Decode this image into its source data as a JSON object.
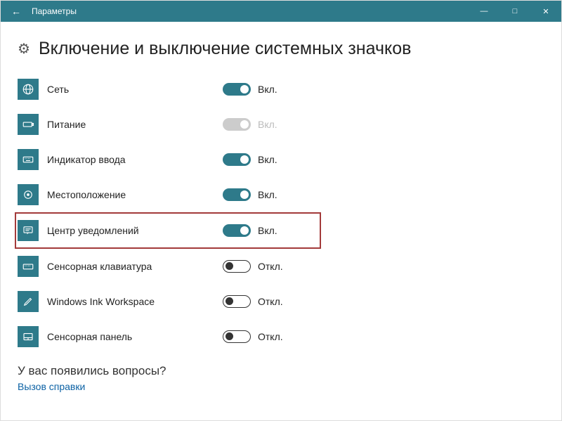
{
  "titlebar": {
    "title": "Параметры"
  },
  "heading": "Включение и выключение системных значков",
  "on_label": "Вкл.",
  "off_label": "Откл.",
  "items": {
    "network": {
      "label": "Сеть",
      "state": "on",
      "icon": "globe"
    },
    "power": {
      "label": "Питание",
      "state": "disabled",
      "icon": "battery"
    },
    "input": {
      "label": "Индикатор ввода",
      "state": "on",
      "icon": "keyboard"
    },
    "location": {
      "label": "Местоположение",
      "state": "on",
      "icon": "location"
    },
    "action": {
      "label": "Центр уведомлений",
      "state": "on",
      "icon": "action-center"
    },
    "touchkb": {
      "label": "Сенсорная клавиатура",
      "state": "off",
      "icon": "touchkb"
    },
    "ink": {
      "label": "Windows Ink Workspace",
      "state": "off",
      "icon": "pen"
    },
    "touchpad": {
      "label": "Сенсорная панель",
      "state": "off",
      "icon": "touchpad"
    }
  },
  "footer": {
    "question": "У вас появились вопросы?",
    "help_link": "Вызов справки"
  }
}
